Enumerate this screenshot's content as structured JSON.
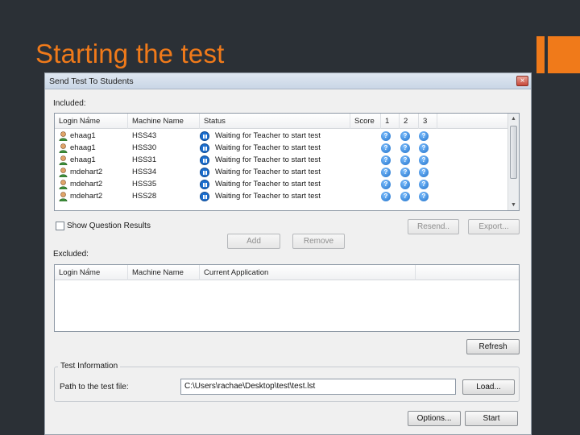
{
  "slide": {
    "title": "Starting the test"
  },
  "window": {
    "title": "Send Test To Students",
    "close_glyph": "×"
  },
  "included": {
    "label": "Included:",
    "columns": [
      "Login Name",
      "Machine Name",
      "Status",
      "Score",
      "1",
      "2",
      "3"
    ],
    "rows": [
      {
        "login": "ehaag1",
        "machine": "HSS43",
        "status": "Waiting for Teacher to start test"
      },
      {
        "login": "ehaag1",
        "machine": "HSS30",
        "status": "Waiting for Teacher to start test"
      },
      {
        "login": "ehaag1",
        "machine": "HSS31",
        "status": "Waiting for Teacher to start test"
      },
      {
        "login": "mdehart2",
        "machine": "HSS34",
        "status": "Waiting for Teacher to start test"
      },
      {
        "login": "mdehart2",
        "machine": "HSS35",
        "status": "Waiting for Teacher to start test"
      },
      {
        "login": "mdehart2",
        "machine": "HSS28",
        "status": "Waiting for Teacher to start test"
      }
    ],
    "question_glyph": "?"
  },
  "show_results": {
    "label": "Show Question Results",
    "checked": false
  },
  "buttons": {
    "resend": "Resend..",
    "export": "Export...",
    "add": "Add",
    "remove": "Remove",
    "refresh": "Refresh",
    "load": "Load...",
    "options": "Options...",
    "start": "Start"
  },
  "excluded": {
    "label": "Excluded:",
    "columns": [
      "Login Name",
      "Machine Name",
      "Current Application"
    ]
  },
  "test_info": {
    "group_title": "Test Information",
    "path_label": "Path to the test file:",
    "path_value": "C:\\Users\\rachae\\Desktop\\test\\test.lst"
  },
  "icons": {
    "user": "user-icon",
    "status": "pause-status-icon",
    "question": "question-icon",
    "close": "close-icon",
    "scroll_up": "scroll-up-icon",
    "scroll_down": "scroll-down-icon"
  },
  "colors": {
    "accent": "#f07a1a",
    "background": "#2b3036",
    "status_blue": "#1b6fd0"
  }
}
